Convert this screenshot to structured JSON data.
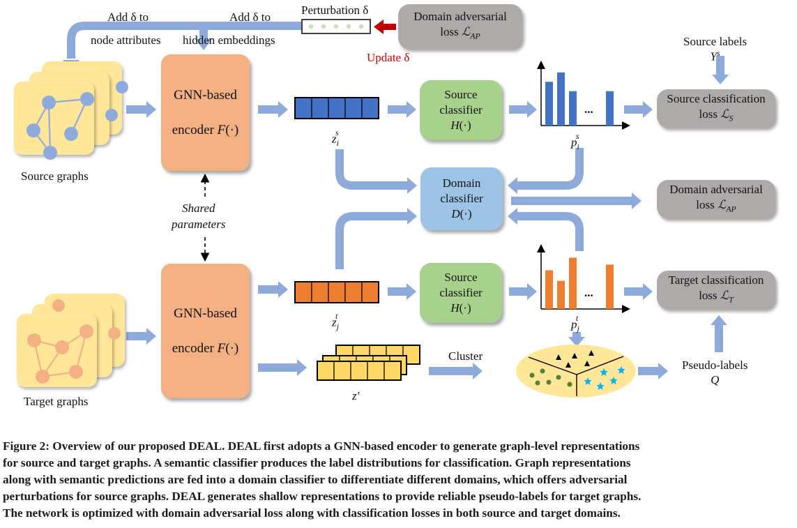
{
  "figure": {
    "perturbation": {
      "label": "Perturbation δ",
      "update_label": "Update δ",
      "add_to_nodes_line1": "Add δ to",
      "add_to_nodes_line2": "node attributes",
      "add_to_hidden_line1": "Add δ to",
      "add_to_hidden_line2": "hidden embeddings",
      "dot_count": 5
    },
    "top_loss": {
      "line1": "Domain adversarial",
      "line2_prefix": "loss ",
      "symbol": "ℒ",
      "sub": "AP"
    },
    "source_graphs_label": "Source graphs",
    "target_graphs_label": "Target graphs",
    "encoder_source": {
      "line1": "GNN-based",
      "line2_prefix": "encoder ",
      "func": "F",
      "arg": "(·)"
    },
    "encoder_target": {
      "line1": "GNN-based",
      "line2_prefix": "encoder ",
      "func": "F",
      "arg": "(·)"
    },
    "shared_params": {
      "line1": "Shared",
      "line2": "parameters"
    },
    "z_source": {
      "base": "z",
      "sub": "i",
      "sup": "s"
    },
    "z_target": {
      "base": "z",
      "sub": "j",
      "sup": "t"
    },
    "z_prime": "z′",
    "source_classifier_top": {
      "line1": "Source",
      "line2": "classifier",
      "func": "H",
      "arg": "(·)"
    },
    "source_classifier_bottom": {
      "line1": "Source",
      "line2": "classifier",
      "func": "H",
      "arg": "(·)"
    },
    "domain_classifier": {
      "line1": "Domain",
      "line2": "classifier",
      "func": "D",
      "arg": "(·)"
    },
    "p_source": {
      "base": "p",
      "sub": "i",
      "sup": "s",
      "bars": [
        0.7,
        0.85,
        0.55,
        0.55
      ],
      "ellipsis": "..."
    },
    "p_target": {
      "base": "p",
      "sub": "j",
      "sup": "t",
      "bars": [
        0.62,
        0.45,
        0.82,
        0.71
      ],
      "ellipsis": "..."
    },
    "source_labels": {
      "line1": "Source labels",
      "base": "Y",
      "sup": "s"
    },
    "source_loss": {
      "line1": "Source classification",
      "line2_prefix": "loss ",
      "symbol": "ℒ",
      "sub": "S"
    },
    "domain_loss": {
      "line1": "Domain adversarial",
      "line2_prefix": "loss ",
      "symbol": "ℒ",
      "sub": "AP"
    },
    "target_loss": {
      "line1": "Target classification",
      "line2_prefix": "loss ",
      "symbol": "ℒ",
      "sub": "T"
    },
    "cluster_label": "Cluster",
    "pseudo_labels": {
      "line1": "Pseudo-labels",
      "symbol": "Q"
    },
    "colors": {
      "arrow": "#8eaadb",
      "source_blue": "#4472c4",
      "target_orange": "#ed7d31",
      "graph_card": "#ffe699",
      "source_node": "#8faadc",
      "target_node": "#f4b183",
      "encoder": "#f3b083",
      "classifier_green": "#a9d18e",
      "domain_blue": "#9dc3e6",
      "loss_gray": "#aeaaaa",
      "update_red": "#c00000",
      "cluster_fill": "#ffe699",
      "cluster_circle": "#548235",
      "cluster_star": "#00b0f0",
      "perturb_dot": "#c5e0b4"
    }
  },
  "caption": {
    "lines": [
      "Figure 2: Overview of our proposed DEAL. DEAL first adopts a GNN-based encoder to generate graph-level representations",
      "for source and target graphs. A semantic classifier produces the label distributions for classification. Graph representations",
      "along with semantic predictions are fed into a domain classifier to differentiate different domains, which offers adversarial",
      "perturbations for source graphs. DEAL generates shallow representations to provide reliable pseudo-labels for target graphs.",
      "The network is optimized with domain adversarial loss along with classification losses in both source and target domains."
    ]
  }
}
